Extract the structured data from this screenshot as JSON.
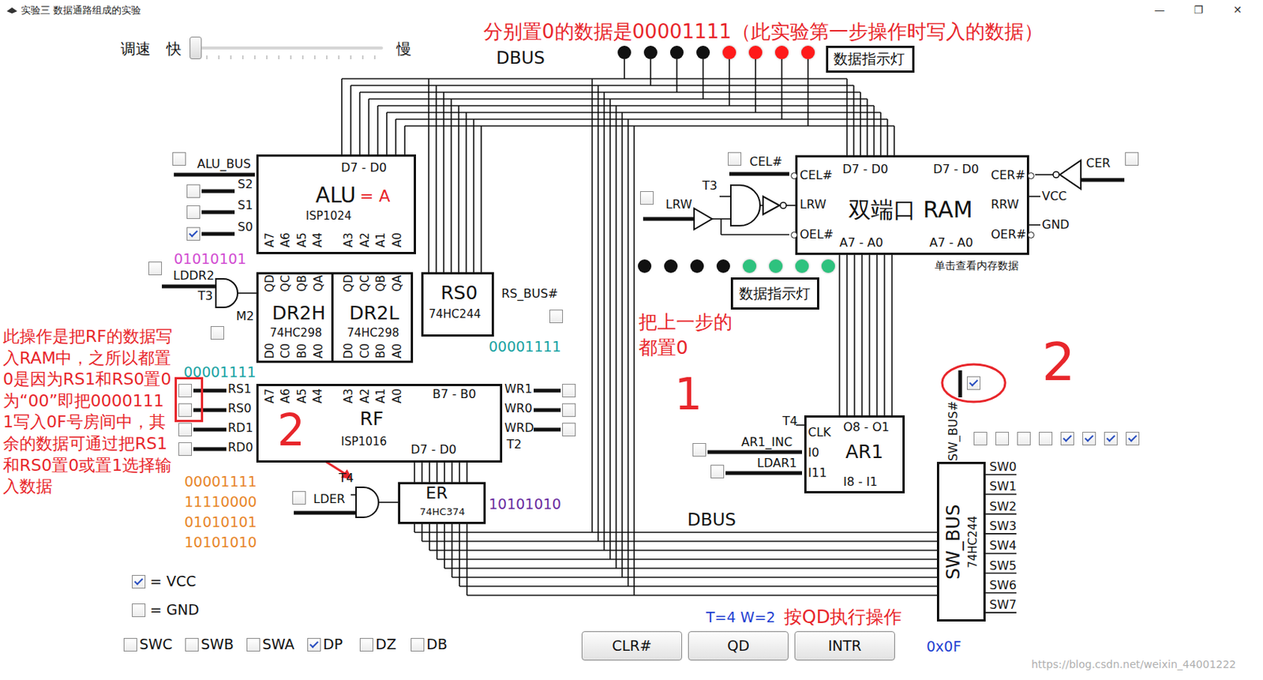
{
  "window": {
    "title": "实验三 数据通路组成的实验",
    "controls": [
      "—",
      "❐",
      "✕"
    ]
  },
  "speed": {
    "label": "调速",
    "fast": "快",
    "slow": "慢",
    "level": 0
  },
  "notes": {
    "top": "分别置0的数据是00001111（此实验第一步操作时写入的数据）",
    "left": "此操作是把RF的数据写入RAM中，之所以都置0是因为RS1和RS0置0为“00”即把00001111写入0F号房间中，其余的数据可通过把RS1和RS0置0或置1选择输入数据",
    "middle": "把上一步的都置0",
    "step1": "1",
    "step2_left": "2",
    "step2_right": "2"
  },
  "bus_labels": [
    "DBUS",
    "DBUS"
  ],
  "leds_top": {
    "label": "数据指示灯",
    "lights": [
      {
        "on": false,
        "color": "#111111"
      },
      {
        "on": false,
        "color": "#111111"
      },
      {
        "on": false,
        "color": "#111111"
      },
      {
        "on": false,
        "color": "#111111"
      },
      {
        "on": true,
        "color": "#ff1a1a"
      },
      {
        "on": true,
        "color": "#ff1a1a"
      },
      {
        "on": true,
        "color": "#ff1a1a"
      },
      {
        "on": true,
        "color": "#ff1a1a"
      }
    ]
  },
  "leds_ram": {
    "label": "数据指示灯",
    "lights": [
      {
        "on": false,
        "color": "#111111"
      },
      {
        "on": false,
        "color": "#111111"
      },
      {
        "on": false,
        "color": "#111111"
      },
      {
        "on": false,
        "color": "#111111"
      },
      {
        "on": true,
        "color": "#2ec27e"
      },
      {
        "on": true,
        "color": "#2ec27e"
      },
      {
        "on": true,
        "color": "#2ec27e"
      },
      {
        "on": true,
        "color": "#2ec27e"
      }
    ]
  },
  "alu": {
    "bus": {
      "label": "ALU_BUS",
      "checked": false
    },
    "select": [
      {
        "label": "S2",
        "checked": false
      },
      {
        "label": "S1",
        "checked": false
      },
      {
        "label": "S0",
        "checked": true
      }
    ],
    "data": "D7 - D0",
    "name": "ALU",
    "function": "= A",
    "chip": "ISP1024",
    "pins": [
      "A7",
      "A6",
      "A5",
      "A4",
      "A3",
      "A2",
      "A1",
      "A0"
    ],
    "value": "01010101"
  },
  "dr2": {
    "load": {
      "label": "LDDR2",
      "checked": false
    },
    "clock": "T3",
    "mode": {
      "label": "M2",
      "checked": false
    },
    "regs": [
      {
        "name": "DR2H",
        "chip": "74HC298",
        "outputs": [
          "QD",
          "QC",
          "QB",
          "QA"
        ],
        "inputs": [
          "D0",
          "C0",
          "B0",
          "A0"
        ]
      },
      {
        "name": "DR2L",
        "chip": "74HC298",
        "outputs": [
          "QD",
          "QC",
          "QB",
          "QA"
        ],
        "inputs": [
          "D0",
          "C0",
          "B0",
          "A0"
        ]
      }
    ]
  },
  "rs0": {
    "name": "RS0",
    "chip": "74HC244",
    "enable": {
      "label": "RS_BUS#",
      "checked": false
    },
    "value": "00001111"
  },
  "rf": {
    "value": "00001111",
    "read": [
      {
        "label": "RS1",
        "checked": false
      },
      {
        "label": "RS0",
        "checked": false
      },
      {
        "label": "RD1",
        "checked": false
      },
      {
        "label": "RD0",
        "checked": false
      }
    ],
    "write": [
      {
        "label": "WR1",
        "checked": false
      },
      {
        "label": "WR0",
        "checked": false
      },
      {
        "label": "WRD",
        "checked": false
      }
    ],
    "clock": "T2",
    "pins": [
      "A7",
      "A6",
      "A5",
      "A4",
      "A3",
      "A2",
      "A1",
      "A0"
    ],
    "data_in": "B7 - B0",
    "name": "RF",
    "chip": "ISP1016",
    "data_out": "D7 - D0",
    "registers": [
      "00001111",
      "11110000",
      "01010101",
      "10101010"
    ]
  },
  "er": {
    "clock": "T4",
    "load": {
      "label": "LDER",
      "checked": false
    },
    "name": "ER",
    "chip": "74HC374",
    "value": "10101010"
  },
  "ram": {
    "left": {
      "cel": {
        "label": "CEL#",
        "checked": false
      },
      "lrw": {
        "label": "LRW",
        "checked": false
      },
      "clock": "T3",
      "pins": [
        "CEL#",
        "LRW",
        "OEL#"
      ],
      "data": "D7 - D0",
      "addr": "A7 - A0"
    },
    "right": {
      "cer": {
        "label": "CER",
        "checked": false
      },
      "pins": [
        "CER#",
        "RRW",
        "OER#"
      ],
      "data": "D7 - D0",
      "addr": "A7 - A0",
      "vcc": "VCC",
      "gnd": "GND"
    },
    "name": "双端口 RAM",
    "hint": "单击查看内存数据"
  },
  "ar1": {
    "clock": "T4",
    "inc": {
      "label": "AR1_INC",
      "checked": false
    },
    "load": {
      "label": "LDAR1",
      "checked": false
    },
    "pins": [
      "CLK",
      "I0",
      "I11"
    ],
    "out": "O8 - O1",
    "in": "I8 - I1",
    "name": "AR1"
  },
  "sw": {
    "enable": {
      "label": "SW_BUS#",
      "checked": true
    },
    "switches": [
      {
        "checked": false
      },
      {
        "checked": false
      },
      {
        "checked": false
      },
      {
        "checked": false
      },
      {
        "checked": true
      },
      {
        "checked": true
      },
      {
        "checked": true
      },
      {
        "checked": true
      }
    ],
    "name": "SW_BUS",
    "chip": "74HC244",
    "outputs": [
      "SW0",
      "SW1",
      "SW2",
      "SW3",
      "SW4",
      "SW5",
      "SW6",
      "SW7"
    ],
    "value": "0x0F"
  },
  "legend": [
    {
      "label": "= VCC",
      "checked": true
    },
    {
      "label": "= GND",
      "checked": false
    }
  ],
  "modes": [
    {
      "label": "SWC",
      "checked": false
    },
    {
      "label": "SWB",
      "checked": false
    },
    {
      "label": "SWA",
      "checked": false
    },
    {
      "label": "DP",
      "checked": true
    },
    {
      "label": "DZ",
      "checked": false
    },
    {
      "label": "DB",
      "checked": false
    }
  ],
  "buttons": [
    "CLR#",
    "QD",
    "INTR"
  ],
  "status": {
    "timing": "T=4 W=2",
    "hint": "按QD执行操作"
  },
  "watermark": "https://blog.csdn.net/weixin_44001222"
}
